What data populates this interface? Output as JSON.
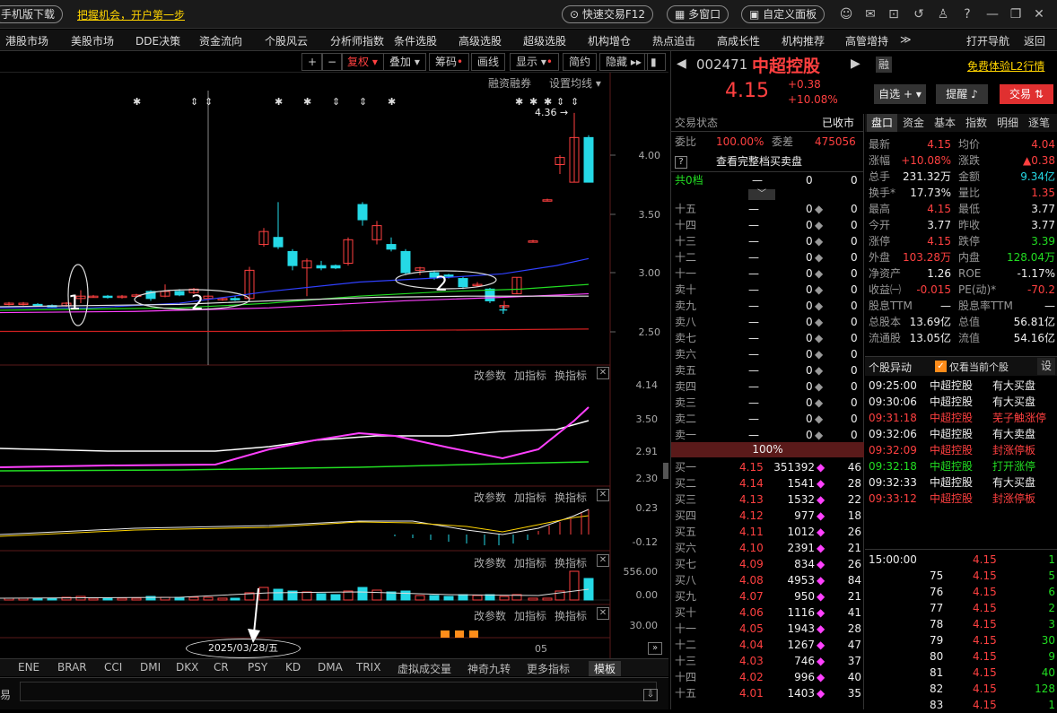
{
  "topbar": {
    "mobile_download": "手机版下载",
    "promo": "把握机会，开户第一步",
    "fast_trade": "快速交易F12",
    "multi_window": "多窗口",
    "custom_panel": "自定义面板"
  },
  "menu": [
    "港股市场",
    "美股市场",
    "DDE决策",
    "资金流向",
    "个股风云",
    "分析师指数",
    "条件选股",
    "高级选股",
    "超级选股",
    "机构增仓",
    "热点追击",
    "高成长性",
    "机构推荐",
    "高管增持",
    "≫",
    "打开导航",
    "返回"
  ],
  "chart_toolbar": {
    "restore": "复权",
    "overlay": "叠加",
    "chips": "筹码",
    "draw": "画线",
    "display": "显示",
    "simple": "简约",
    "hide": "隐藏"
  },
  "chart_sub": {
    "margin": "融资融券",
    "ma_set": "设置均线"
  },
  "price_axis": [
    "4.00",
    "3.50",
    "3.00",
    "2.50"
  ],
  "high_label": "4.36",
  "annotations": {
    "a1": "1",
    "a2": "2",
    "a3": "2"
  },
  "indicator_panels": [
    {
      "params": "改参数",
      "add": "加指标",
      "switch": "换指标",
      "axis": [
        "4.14",
        "3.50",
        "2.91",
        "2.30"
      ]
    },
    {
      "params": "改参数",
      "add": "加指标",
      "switch": "换指标",
      "axis": [
        "0.23",
        "-0.12"
      ]
    },
    {
      "params": "改参数",
      "add": "加指标",
      "switch": "换指标",
      "axis": [
        "556.00",
        "0.00"
      ]
    },
    {
      "params": "改参数",
      "add": "加指标",
      "switch": "换指标",
      "axis": [
        "30.00"
      ]
    }
  ],
  "date_label": "2025/03/28/五",
  "month_label": "05",
  "bottom_tabs": [
    "ENE",
    "BRAR",
    "CCI",
    "DMI",
    "DKX",
    "CR",
    "PSY",
    "KD",
    "DMA",
    "TRIX",
    "虚拟成交量",
    "神奇九转",
    "更多指标",
    "模板"
  ],
  "stock": {
    "code": "002471",
    "name": "中超控股",
    "tag": "融",
    "l2": "免费体验L2行情",
    "price": "4.15",
    "chg": "+0.38",
    "pct": "+10.08%",
    "watch": "自选",
    "remind": "提醒",
    "trade": "交易"
  },
  "trade_status": {
    "label": "交易状态",
    "value": "已收市"
  },
  "wei": {
    "ratio_l": "委比",
    "ratio": "100.00%",
    "diff_l": "委差",
    "diff": "475056"
  },
  "view_full": "查看完整档买卖盘",
  "total_levels": {
    "label": "共0档",
    "dash": "—",
    "v1": "0",
    "v2": "0"
  },
  "sell_levels": [
    [
      "十五",
      "—",
      "0",
      "0"
    ],
    [
      "十四",
      "—",
      "0",
      "0"
    ],
    [
      "十三",
      "—",
      "0",
      "0"
    ],
    [
      "十二",
      "—",
      "0",
      "0"
    ],
    [
      "十一",
      "—",
      "0",
      "0"
    ],
    [
      "卖十",
      "—",
      "0",
      "0"
    ],
    [
      "卖九",
      "—",
      "0",
      "0"
    ],
    [
      "卖八",
      "—",
      "0",
      "0"
    ],
    [
      "卖七",
      "—",
      "0",
      "0"
    ],
    [
      "卖六",
      "—",
      "0",
      "0"
    ],
    [
      "卖五",
      "—",
      "0",
      "0"
    ],
    [
      "卖四",
      "—",
      "0",
      "0"
    ],
    [
      "卖三",
      "—",
      "0",
      "0"
    ],
    [
      "卖二",
      "—",
      "0",
      "0"
    ],
    [
      "卖一",
      "—",
      "0",
      "0"
    ]
  ],
  "pct_bar": "100%",
  "buy_levels": [
    [
      "买一",
      "4.15",
      "351392",
      "46"
    ],
    [
      "买二",
      "4.14",
      "1541",
      "28"
    ],
    [
      "买三",
      "4.13",
      "1532",
      "22"
    ],
    [
      "买四",
      "4.12",
      "977",
      "18"
    ],
    [
      "买五",
      "4.11",
      "1012",
      "26"
    ],
    [
      "买六",
      "4.10",
      "2391",
      "21"
    ],
    [
      "买七",
      "4.09",
      "834",
      "26"
    ],
    [
      "买八",
      "4.08",
      "4953",
      "84"
    ],
    [
      "买九",
      "4.07",
      "950",
      "21"
    ],
    [
      "买十",
      "4.06",
      "1116",
      "41"
    ],
    [
      "十一",
      "4.05",
      "1943",
      "28"
    ],
    [
      "十二",
      "4.04",
      "1267",
      "47"
    ],
    [
      "十三",
      "4.03",
      "746",
      "37"
    ],
    [
      "十四",
      "4.02",
      "996",
      "40"
    ],
    [
      "十五",
      "4.01",
      "1403",
      "35"
    ]
  ],
  "quote_tabs": [
    "盘口",
    "资金",
    "基本",
    "指数",
    "明细",
    "逐笔"
  ],
  "quote": [
    [
      "最新",
      "4.15",
      "均价",
      "4.04"
    ],
    [
      "涨幅",
      "+10.08%",
      "涨跌",
      "▲0.38"
    ],
    [
      "总手",
      "231.32万",
      "金额",
      "9.34亿"
    ],
    [
      "换手*",
      "17.73%",
      "量比",
      "1.35"
    ],
    [
      "最高",
      "4.15",
      "最低",
      "3.77"
    ],
    [
      "今开",
      "3.77",
      "昨收",
      "3.77"
    ],
    [
      "涨停",
      "4.15",
      "跌停",
      "3.39"
    ],
    [
      "外盘",
      "103.28万",
      "内盘",
      "128.04万"
    ],
    [
      "净资产",
      "1.26",
      "ROE",
      "-1.17%"
    ],
    [
      "收益㈠",
      "-0.015",
      "PE(动)*",
      "-70.2"
    ],
    [
      "股息TTM",
      "—",
      "股息率TTM",
      "—"
    ],
    [
      "总股本",
      "13.69亿",
      "总值",
      "56.81亿"
    ],
    [
      "流通股",
      "13.05亿",
      "流值",
      "54.16亿"
    ]
  ],
  "abnormal": {
    "title": "个股异动",
    "only_current": "仅看当前个股",
    "set": "设",
    "events": [
      [
        "09:25:00",
        "中超控股",
        "有大买盘"
      ],
      [
        "09:30:06",
        "中超控股",
        "有大买盘"
      ],
      [
        "09:31:18",
        "中超控股",
        "芜子触涨停"
      ],
      [
        "09:32:06",
        "中超控股",
        "有大卖盘"
      ],
      [
        "09:32:09",
        "中超控股",
        "封涨停板"
      ],
      [
        "09:32:18",
        "中超控股",
        "打开涨停"
      ],
      [
        "09:32:33",
        "中超控股",
        "有大买盘"
      ],
      [
        "09:33:12",
        "中超控股",
        "封涨停板"
      ]
    ]
  },
  "ticks": [
    [
      "15:00:00",
      "4.15",
      "1"
    ],
    [
      "75",
      "4.15",
      "5"
    ],
    [
      "76",
      "4.15",
      "6"
    ],
    [
      "77",
      "4.15",
      "2"
    ],
    [
      "78",
      "4.15",
      "3"
    ],
    [
      "79",
      "4.15",
      "30"
    ],
    [
      "80",
      "4.15",
      "9"
    ],
    [
      "81",
      "4.15",
      "40"
    ],
    [
      "82",
      "4.15",
      "128"
    ],
    [
      "83",
      "4.15",
      "1"
    ]
  ],
  "bottom_left": "易",
  "colors": {
    "up": "#ff4040",
    "down": "#25d9e6",
    "bg": "#000000"
  }
}
